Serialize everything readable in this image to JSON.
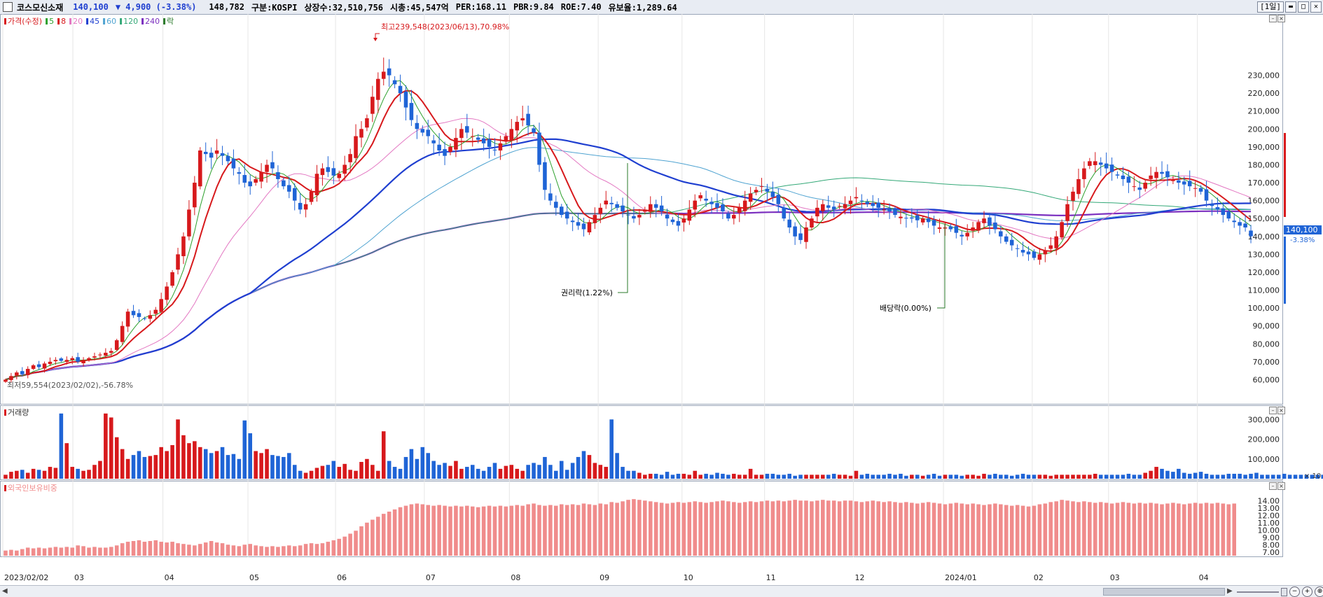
{
  "header": {
    "stock_name": "코스모신소재",
    "price": "140,100",
    "change": "▼ 4,900 (-3.38%)",
    "volume": "148,782",
    "market": "구분:KOSPI",
    "listed": "상장수:32,510,756",
    "market_cap": "시총:45,547억",
    "per": "PER:168.11",
    "pbr": "PBR:9.84",
    "roe": "ROE:7.40",
    "float": "유보율:1,289.64",
    "period": "[1일]"
  },
  "price_legend": [
    {
      "label": "가격(수정)",
      "color": "#d7191c"
    },
    {
      "label": "5",
      "color": "#2ca02c"
    },
    {
      "label": "8",
      "color": "#d7191c"
    },
    {
      "label": "20",
      "color": "#e377c2"
    },
    {
      "label": "45",
      "color": "#1f3fd0"
    },
    {
      "label": "60",
      "color": "#4fa3d1"
    },
    {
      "label": "120",
      "color": "#33a877"
    },
    {
      "label": "240",
      "color": "#7b2fbf"
    },
    {
      "label": "락",
      "color": "#2a7a2a"
    }
  ],
  "annotations": {
    "high": "최고239,548(2023/06/13),70.98%",
    "low": "최저59,554(2023/02/02),-56.78%",
    "rights": "권리락(1.22%)",
    "dividend": "배당락(0.00%)"
  },
  "price_axis": [
    "230,000",
    "220,000",
    "210,000",
    "200,000",
    "190,000",
    "180,000",
    "170,000",
    "160,000",
    "150,000",
    "140,000",
    "130,000",
    "120,000",
    "110,000",
    "100,000",
    "90,000",
    "80,000",
    "70,000",
    "60,000"
  ],
  "current_price_tag": {
    "price": "140,100",
    "pct": "-3.38%"
  },
  "volume_panel": {
    "label": "거래량",
    "axis": [
      "300,000",
      "200,000",
      "100,000"
    ],
    "unit": "× 10"
  },
  "foreign_panel": {
    "label": "외국인보유비중",
    "axis": [
      "14.00",
      "13.00",
      "12.00",
      "11.00",
      "10.00",
      "9.00",
      "8.00",
      "7.00"
    ]
  },
  "x_axis": [
    "2023/02/02",
    "03",
    "04",
    "05",
    "06",
    "07",
    "08",
    "09",
    "10",
    "11",
    "12",
    "2024/01",
    "02",
    "03",
    "04"
  ],
  "colors": {
    "up": "#d7191c",
    "down": "#1f64d6",
    "foreign": "#f08c8c",
    "grid": "#e6e6e6"
  },
  "chart_data": {
    "type": "candlestick",
    "y_range": [
      50000,
      240000
    ],
    "closes": [
      60000,
      62000,
      64000,
      63000,
      66000,
      68000,
      67000,
      69000,
      70000,
      71000,
      70500,
      71000,
      72000,
      70000,
      71000,
      72000,
      73000,
      74000,
      75000,
      76000,
      82000,
      90000,
      98000,
      96000,
      95000,
      94000,
      96000,
      99000,
      105000,
      112000,
      120000,
      130000,
      140000,
      155000,
      170000,
      188000,
      186000,
      184000,
      188000,
      185000,
      182000,
      178000,
      175000,
      170000,
      168000,
      172000,
      176000,
      180000,
      178000,
      172000,
      168000,
      165000,
      160000,
      155000,
      158000,
      165000,
      175000,
      178000,
      176000,
      174000,
      175000,
      180000,
      186000,
      196000,
      200000,
      206000,
      218000,
      228000,
      232000,
      230000,
      225000,
      220000,
      212000,
      205000,
      200000,
      198000,
      196000,
      192000,
      188000,
      185000,
      190000,
      195000,
      200000,
      198000,
      196000,
      194000,
      192000,
      190000,
      188000,
      192000,
      196000,
      200000,
      204000,
      206000,
      202000,
      198000,
      180000,
      166000,
      160000,
      156000,
      152000,
      150000,
      148000,
      146000,
      144000,
      148000,
      152000,
      156000,
      160000,
      158000,
      156000,
      154000,
      152000,
      150000,
      152000,
      155000,
      158000,
      156000,
      154000,
      150000,
      148000,
      146000,
      150000,
      155000,
      160000,
      163000,
      160000,
      158000,
      156000,
      154000,
      150000,
      152000,
      156000,
      160000,
      164000,
      166000,
      168000,
      165000,
      162000,
      158000,
      150000,
      145000,
      140000,
      138000,
      145000,
      150000,
      156000,
      158000,
      156000,
      155000,
      157000,
      158000,
      160000,
      162000,
      160000,
      158000,
      157000,
      156000,
      155000,
      154000,
      152000,
      151000,
      150000,
      150000,
      149000,
      150000,
      148000,
      146000,
      145000,
      145000,
      144000,
      142000,
      140000,
      142000,
      145000,
      148000,
      150000,
      146000,
      144000,
      140000,
      137000,
      135000,
      133000,
      131000,
      130000,
      128000,
      130000,
      132000,
      135000,
      140000,
      148000,
      158000,
      165000,
      172000,
      178000,
      182000,
      182000,
      180000,
      178000,
      176000,
      174000,
      172000,
      170000,
      168000,
      166000,
      170000,
      174000,
      176000,
      175000,
      173000,
      172000,
      170000,
      169000,
      168000,
      167000,
      165000,
      160000,
      157000,
      155000,
      152000,
      150000,
      148000,
      146000,
      145000,
      140100
    ],
    "volume": [
      20,
      35,
      40,
      45,
      30,
      50,
      45,
      40,
      60,
      55,
      330,
      180,
      60,
      50,
      40,
      45,
      70,
      90,
      330,
      310,
      210,
      150,
      100,
      120,
      140,
      110,
      115,
      120,
      160,
      140,
      170,
      300,
      220,
      180,
      190,
      160,
      150,
      130,
      140,
      160,
      120,
      125,
      100,
      295,
      230,
      140,
      130,
      150,
      120,
      115,
      110,
      130,
      70,
      40,
      30,
      40,
      55,
      65,
      70,
      90,
      60,
      75,
      45,
      40,
      85,
      100,
      70,
      40,
      240,
      90,
      60,
      50,
      110,
      150,
      100,
      160,
      130,
      90,
      70,
      80,
      65,
      90,
      50,
      60,
      70,
      50,
      40,
      60,
      80,
      50,
      65,
      70,
      50,
      40,
      70,
      80,
      70,
      110,
      70,
      40,
      90,
      45,
      80,
      110,
      140,
      120,
      80,
      70,
      60,
      300,
      130,
      60,
      40,
      40,
      30,
      20,
      25,
      25,
      20,
      35,
      20,
      25,
      25,
      20,
      40,
      20,
      25,
      20,
      30,
      25,
      20,
      25,
      20,
      20,
      50,
      20,
      20,
      25,
      25,
      20,
      20,
      25,
      15,
      20,
      20,
      20,
      20,
      20,
      20,
      25,
      20,
      20,
      15,
      40,
      20,
      25,
      20,
      20,
      20,
      25,
      20,
      25,
      15,
      20,
      20,
      15,
      20,
      25,
      15,
      20,
      20,
      20,
      15,
      20,
      20,
      15,
      25,
      20,
      25,
      20,
      20,
      15,
      20,
      25,
      20,
      20,
      20,
      20,
      15,
      20,
      20,
      20,
      20,
      20,
      20,
      20,
      25,
      20,
      20,
      20,
      20,
      20,
      25,
      20,
      20,
      30,
      40,
      60,
      50,
      40,
      35,
      50,
      30,
      25,
      30,
      35,
      25,
      20,
      20,
      20,
      25,
      25,
      25,
      20,
      25,
      30,
      20,
      20,
      20,
      20,
      25,
      20,
      20,
      20,
      20,
      20,
      20,
      20,
      20,
      20,
      20,
      20,
      20,
      20,
      20,
      20,
      20,
      20,
      15
    ],
    "foreign_pct": [
      7.2,
      7.3,
      7.2,
      7.4,
      7.6,
      7.5,
      7.6,
      7.5,
      7.6,
      7.7,
      7.6,
      7.7,
      7.6,
      7.9,
      7.8,
      7.6,
      7.7,
      7.6,
      7.6,
      7.7,
      7.9,
      8.2,
      8.4,
      8.5,
      8.6,
      8.4,
      8.5,
      8.6,
      8.4,
      8.3,
      8.4,
      8.2,
      8.1,
      8.0,
      7.9,
      8.1,
      8.3,
      8.5,
      8.3,
      8.2,
      8.0,
      7.9,
      7.8,
      8.0,
      8.1,
      7.9,
      7.8,
      7.7,
      7.8,
      7.7,
      7.8,
      7.9,
      7.8,
      7.9,
      8.1,
      8.2,
      8.1,
      8.2,
      8.4,
      8.6,
      8.8,
      9.1,
      9.5,
      9.9,
      10.5,
      11.0,
      11.4,
      11.8,
      12.2,
      12.5,
      12.8,
      13.1,
      13.3,
      13.5,
      13.6,
      13.5,
      13.4,
      13.3,
      13.4,
      13.3,
      13.2,
      13.3,
      13.2,
      13.3,
      13.2,
      13.1,
      13.2,
      13.3,
      13.2,
      13.3,
      13.2,
      13.3,
      13.4,
      13.3,
      13.5,
      13.6,
      13.4,
      13.3,
      13.4,
      13.3,
      13.5,
      13.4,
      13.5,
      13.4,
      13.6,
      13.5,
      13.4,
      13.6,
      13.5,
      13.8,
      13.7,
      13.9,
      14.1,
      14.2,
      14.1,
      14.0,
      13.9,
      13.8,
      13.7,
      13.6,
      13.7,
      13.8,
      13.7,
      13.8,
      13.9,
      13.8,
      13.7,
      13.8,
      13.9,
      14.0,
      13.9,
      13.8,
      13.7,
      13.8,
      13.9,
      13.8,
      13.9,
      14.0,
      13.9,
      14.0,
      13.9,
      14.0,
      14.1,
      14.0,
      14.0,
      13.9,
      14.0,
      14.1,
      14.0,
      14.0,
      13.9,
      14.0,
      14.0,
      13.9,
      13.8,
      13.9,
      14.0,
      13.9,
      13.8,
      13.9,
      13.8,
      13.7,
      13.8,
      13.7,
      13.6,
      13.7,
      13.8,
      13.7,
      13.6,
      13.5,
      13.6,
      13.7,
      13.6,
      13.5,
      13.6,
      13.5,
      13.4,
      13.5,
      13.6,
      13.5,
      13.4,
      13.3,
      13.4,
      13.3,
      13.2,
      13.3,
      13.5,
      13.6,
      13.8,
      13.9,
      14.1,
      14.0,
      13.9,
      13.8,
      13.9,
      13.8,
      13.7,
      13.8,
      13.7,
      13.6,
      13.7,
      13.8,
      13.7,
      13.6,
      13.7,
      13.6,
      13.7,
      13.6,
      13.5,
      13.6,
      13.7,
      13.6,
      13.5,
      13.6,
      13.7,
      13.6,
      13.7,
      13.6,
      13.7,
      13.6,
      13.5,
      13.6
    ]
  }
}
